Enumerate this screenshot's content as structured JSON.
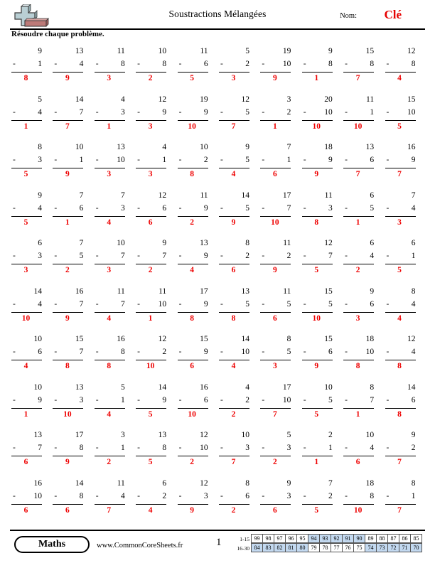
{
  "header": {
    "title": "Soustractions Mélangées",
    "name_label": "Nom:",
    "name_value": "Clé",
    "instructions": "Résoudre chaque problème.",
    "icon": "plus-minus-icon"
  },
  "footer": {
    "subject_badge": "Maths",
    "site_url": "www.CommonCoreSheets.fr",
    "page_number": "1",
    "score_rows": [
      {
        "label": "1-15",
        "values": [
          "99",
          "98",
          "97",
          "96",
          "95",
          "94",
          "93",
          "92",
          "91",
          "90",
          "89",
          "88",
          "87",
          "86",
          "85"
        ],
        "highlighted": [
          false,
          false,
          false,
          false,
          false,
          true,
          true,
          true,
          true,
          true,
          false,
          false,
          false,
          false,
          false
        ]
      },
      {
        "label": "16-30",
        "values": [
          "84",
          "83",
          "82",
          "81",
          "80",
          "79",
          "78",
          "77",
          "76",
          "75",
          "74",
          "73",
          "72",
          "71",
          "70"
        ],
        "highlighted": [
          true,
          true,
          true,
          true,
          true,
          false,
          false,
          false,
          false,
          false,
          true,
          true,
          true,
          true,
          true
        ]
      }
    ]
  },
  "colors": {
    "answer": "#ee0000",
    "name": "#e60000",
    "highlight": "#c3d9f0"
  },
  "operator": "-",
  "problems": [
    [
      {
        "top": "9",
        "bottom": "1",
        "answer": "8"
      },
      {
        "top": "13",
        "bottom": "4",
        "answer": "9"
      },
      {
        "top": "11",
        "bottom": "8",
        "answer": "3"
      },
      {
        "top": "10",
        "bottom": "8",
        "answer": "2"
      },
      {
        "top": "11",
        "bottom": "6",
        "answer": "5"
      },
      {
        "top": "5",
        "bottom": "2",
        "answer": "3"
      },
      {
        "top": "19",
        "bottom": "10",
        "answer": "9"
      },
      {
        "top": "9",
        "bottom": "8",
        "answer": "1"
      },
      {
        "top": "15",
        "bottom": "8",
        "answer": "7"
      },
      {
        "top": "12",
        "bottom": "8",
        "answer": "4"
      }
    ],
    [
      {
        "top": "5",
        "bottom": "4",
        "answer": "1"
      },
      {
        "top": "14",
        "bottom": "7",
        "answer": "7"
      },
      {
        "top": "4",
        "bottom": "3",
        "answer": "1"
      },
      {
        "top": "12",
        "bottom": "9",
        "answer": "3"
      },
      {
        "top": "19",
        "bottom": "9",
        "answer": "10"
      },
      {
        "top": "12",
        "bottom": "5",
        "answer": "7"
      },
      {
        "top": "3",
        "bottom": "2",
        "answer": "1"
      },
      {
        "top": "20",
        "bottom": "10",
        "answer": "10"
      },
      {
        "top": "11",
        "bottom": "1",
        "answer": "10"
      },
      {
        "top": "15",
        "bottom": "10",
        "answer": "5"
      }
    ],
    [
      {
        "top": "8",
        "bottom": "3",
        "answer": "5"
      },
      {
        "top": "10",
        "bottom": "1",
        "answer": "9"
      },
      {
        "top": "13",
        "bottom": "10",
        "answer": "3"
      },
      {
        "top": "4",
        "bottom": "1",
        "answer": "3"
      },
      {
        "top": "10",
        "bottom": "2",
        "answer": "8"
      },
      {
        "top": "9",
        "bottom": "5",
        "answer": "4"
      },
      {
        "top": "7",
        "bottom": "1",
        "answer": "6"
      },
      {
        "top": "18",
        "bottom": "9",
        "answer": "9"
      },
      {
        "top": "13",
        "bottom": "6",
        "answer": "7"
      },
      {
        "top": "16",
        "bottom": "9",
        "answer": "7"
      }
    ],
    [
      {
        "top": "9",
        "bottom": "4",
        "answer": "5"
      },
      {
        "top": "7",
        "bottom": "6",
        "answer": "1"
      },
      {
        "top": "7",
        "bottom": "3",
        "answer": "4"
      },
      {
        "top": "12",
        "bottom": "6",
        "answer": "6"
      },
      {
        "top": "11",
        "bottom": "9",
        "answer": "2"
      },
      {
        "top": "14",
        "bottom": "5",
        "answer": "9"
      },
      {
        "top": "17",
        "bottom": "7",
        "answer": "10"
      },
      {
        "top": "11",
        "bottom": "3",
        "answer": "8"
      },
      {
        "top": "6",
        "bottom": "5",
        "answer": "1"
      },
      {
        "top": "7",
        "bottom": "4",
        "answer": "3"
      }
    ],
    [
      {
        "top": "6",
        "bottom": "3",
        "answer": "3"
      },
      {
        "top": "7",
        "bottom": "5",
        "answer": "2"
      },
      {
        "top": "10",
        "bottom": "7",
        "answer": "3"
      },
      {
        "top": "9",
        "bottom": "7",
        "answer": "2"
      },
      {
        "top": "13",
        "bottom": "9",
        "answer": "4"
      },
      {
        "top": "8",
        "bottom": "2",
        "answer": "6"
      },
      {
        "top": "11",
        "bottom": "2",
        "answer": "9"
      },
      {
        "top": "12",
        "bottom": "7",
        "answer": "5"
      },
      {
        "top": "6",
        "bottom": "4",
        "answer": "2"
      },
      {
        "top": "6",
        "bottom": "1",
        "answer": "5"
      }
    ],
    [
      {
        "top": "14",
        "bottom": "4",
        "answer": "10"
      },
      {
        "top": "16",
        "bottom": "7",
        "answer": "9"
      },
      {
        "top": "11",
        "bottom": "7",
        "answer": "4"
      },
      {
        "top": "11",
        "bottom": "10",
        "answer": "1"
      },
      {
        "top": "17",
        "bottom": "9",
        "answer": "8"
      },
      {
        "top": "13",
        "bottom": "5",
        "answer": "8"
      },
      {
        "top": "11",
        "bottom": "5",
        "answer": "6"
      },
      {
        "top": "15",
        "bottom": "5",
        "answer": "10"
      },
      {
        "top": "9",
        "bottom": "6",
        "answer": "3"
      },
      {
        "top": "8",
        "bottom": "4",
        "answer": "4"
      }
    ],
    [
      {
        "top": "10",
        "bottom": "6",
        "answer": "4"
      },
      {
        "top": "15",
        "bottom": "7",
        "answer": "8"
      },
      {
        "top": "16",
        "bottom": "8",
        "answer": "8"
      },
      {
        "top": "12",
        "bottom": "2",
        "answer": "10"
      },
      {
        "top": "15",
        "bottom": "9",
        "answer": "6"
      },
      {
        "top": "14",
        "bottom": "10",
        "answer": "4"
      },
      {
        "top": "8",
        "bottom": "5",
        "answer": "3"
      },
      {
        "top": "15",
        "bottom": "6",
        "answer": "9"
      },
      {
        "top": "18",
        "bottom": "10",
        "answer": "8"
      },
      {
        "top": "12",
        "bottom": "4",
        "answer": "8"
      }
    ],
    [
      {
        "top": "10",
        "bottom": "9",
        "answer": "1"
      },
      {
        "top": "13",
        "bottom": "3",
        "answer": "10"
      },
      {
        "top": "5",
        "bottom": "1",
        "answer": "4"
      },
      {
        "top": "14",
        "bottom": "9",
        "answer": "5"
      },
      {
        "top": "16",
        "bottom": "6",
        "answer": "10"
      },
      {
        "top": "4",
        "bottom": "2",
        "answer": "2"
      },
      {
        "top": "17",
        "bottom": "10",
        "answer": "7"
      },
      {
        "top": "10",
        "bottom": "5",
        "answer": "5"
      },
      {
        "top": "8",
        "bottom": "7",
        "answer": "1"
      },
      {
        "top": "14",
        "bottom": "6",
        "answer": "8"
      }
    ],
    [
      {
        "top": "13",
        "bottom": "7",
        "answer": "6"
      },
      {
        "top": "17",
        "bottom": "8",
        "answer": "9"
      },
      {
        "top": "3",
        "bottom": "1",
        "answer": "2"
      },
      {
        "top": "13",
        "bottom": "8",
        "answer": "5"
      },
      {
        "top": "12",
        "bottom": "10",
        "answer": "2"
      },
      {
        "top": "10",
        "bottom": "3",
        "answer": "7"
      },
      {
        "top": "5",
        "bottom": "3",
        "answer": "2"
      },
      {
        "top": "2",
        "bottom": "1",
        "answer": "1"
      },
      {
        "top": "10",
        "bottom": "4",
        "answer": "6"
      },
      {
        "top": "9",
        "bottom": "2",
        "answer": "7"
      }
    ],
    [
      {
        "top": "16",
        "bottom": "10",
        "answer": "6"
      },
      {
        "top": "14",
        "bottom": "8",
        "answer": "6"
      },
      {
        "top": "11",
        "bottom": "4",
        "answer": "7"
      },
      {
        "top": "6",
        "bottom": "2",
        "answer": "4"
      },
      {
        "top": "12",
        "bottom": "3",
        "answer": "9"
      },
      {
        "top": "8",
        "bottom": "6",
        "answer": "2"
      },
      {
        "top": "9",
        "bottom": "3",
        "answer": "6"
      },
      {
        "top": "7",
        "bottom": "2",
        "answer": "5"
      },
      {
        "top": "18",
        "bottom": "8",
        "answer": "10"
      },
      {
        "top": "8",
        "bottom": "1",
        "answer": "7"
      }
    ]
  ]
}
